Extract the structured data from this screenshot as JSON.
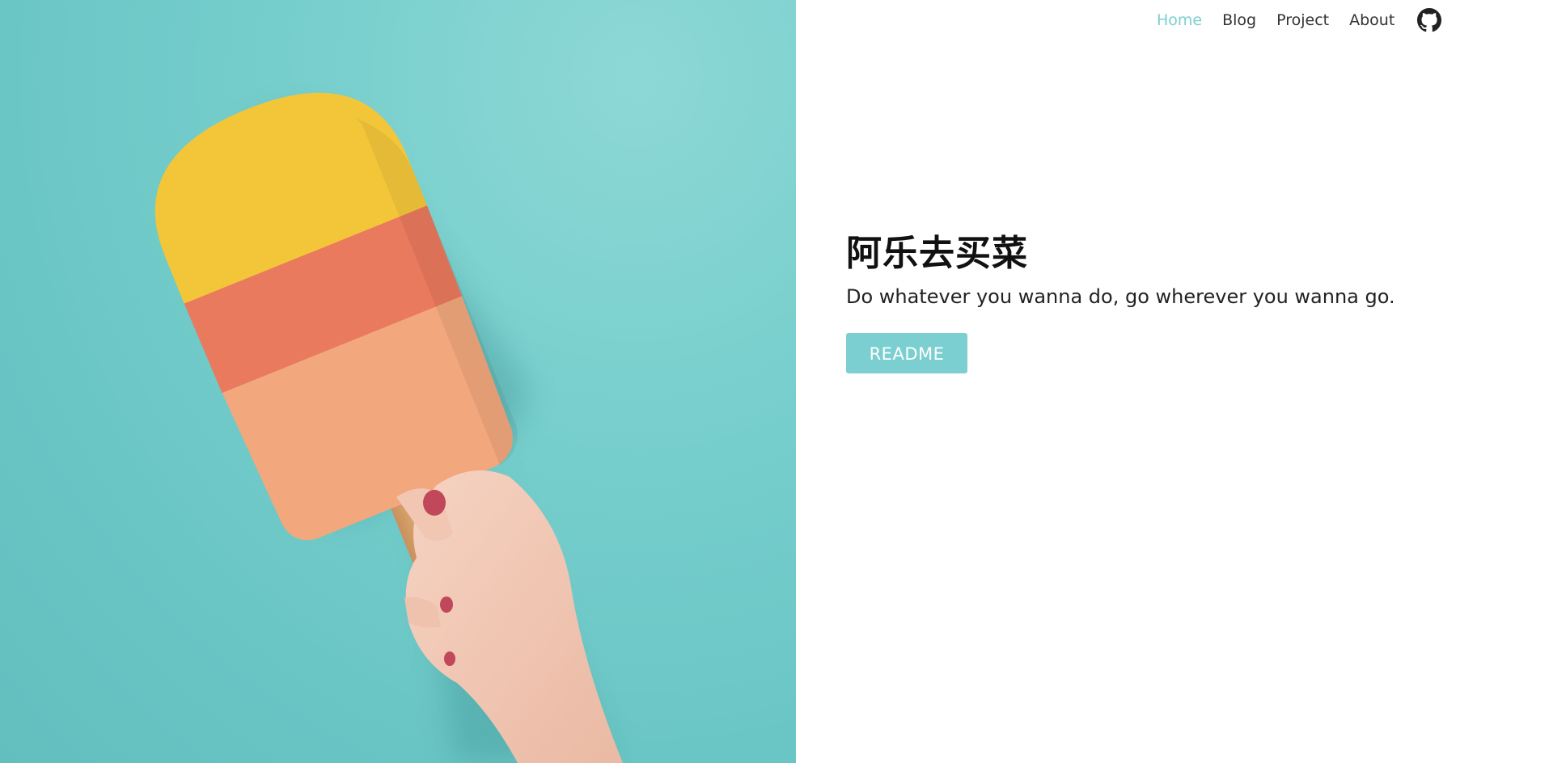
{
  "nav": {
    "items": [
      {
        "label": "Home",
        "active": true
      },
      {
        "label": "Blog",
        "active": false
      },
      {
        "label": "Project",
        "active": false
      },
      {
        "label": "About",
        "active": false
      }
    ],
    "github_icon": "github-icon"
  },
  "hero": {
    "image": "popsicle-photo",
    "background_color": "#6ac6c5"
  },
  "intro": {
    "title": "阿乐去买菜",
    "tagline": "Do whatever you wanna do, go wherever you wanna go.",
    "button_label": "README"
  },
  "colors": {
    "accent": "#7ccfd0",
    "text": "#333333"
  }
}
